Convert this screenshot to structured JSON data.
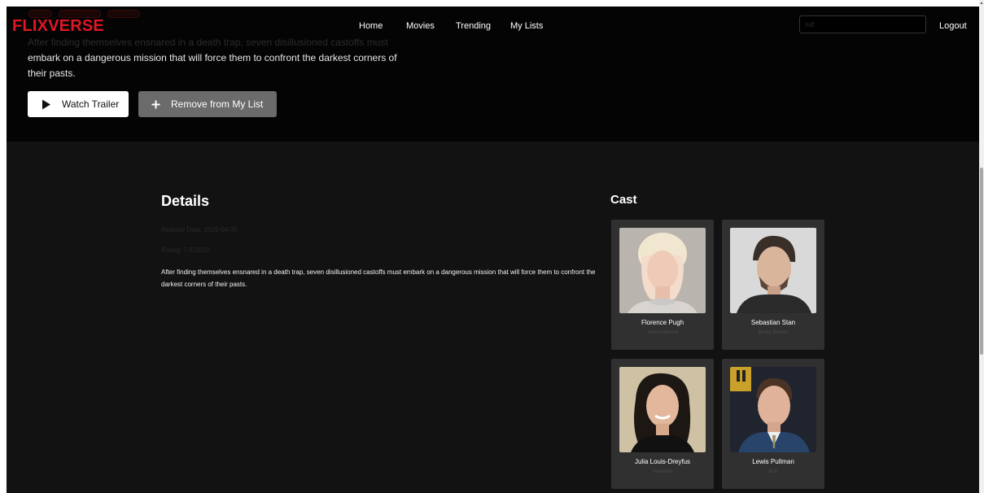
{
  "brand": {
    "logo": "FLIXVERSE"
  },
  "nav": {
    "items": [
      "Home",
      "Movies",
      "Trending",
      "My Lists"
    ],
    "logout": "Logout"
  },
  "search": {
    "value": "ndf",
    "placeholder": ""
  },
  "hero": {
    "genres": [
      "Action",
      "Science Fiction",
      "Adventure"
    ],
    "description_ghost": "After finding themselves ensnared in a death trap, seven disillusioned castoffs must",
    "description_lines": [
      "embark on a dangerous mission that will force them to confront the darkest corners of",
      "their pasts."
    ],
    "watch_trailer": "Watch Trailer",
    "remove_from_list": "Remove from My List"
  },
  "details": {
    "title": "Details",
    "release_date": "Release Date: 2025-04-30",
    "rating": "Rating: 7.523/10",
    "overview": "After finding themselves ensnared in a death trap, seven disillusioned castoffs must embark on a dangerous mission that will force them to confront the darkest corners of their pasts."
  },
  "cast": {
    "title": "Cast",
    "members": [
      {
        "name": "Florence Pugh",
        "character": "Yelena Belova"
      },
      {
        "name": "Sebastian Stan",
        "character": "Bucky Barnes"
      },
      {
        "name": "Julia Louis-Dreyfus",
        "character": "Valentina"
      },
      {
        "name": "Lewis Pullman",
        "character": "Bob"
      }
    ]
  },
  "colors": {
    "brand_red": "#e01623",
    "background": "#121212",
    "hero": "#040404",
    "card": "#303030"
  },
  "icons": {
    "play": "play-icon",
    "plus": "plus-icon"
  }
}
